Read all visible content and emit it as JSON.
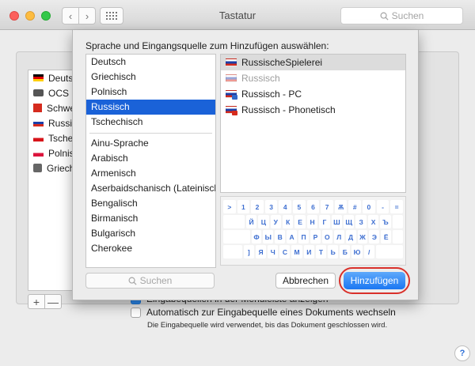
{
  "window": {
    "title": "Tastatur",
    "search_placeholder": "Suchen",
    "nav_back": "‹",
    "nav_forward": "›"
  },
  "background": {
    "inputs": [
      {
        "name": "Deutsch",
        "flag": "de"
      },
      {
        "name": "OCS",
        "flag": "ocs"
      },
      {
        "name": "Schweiz",
        "flag": "ch"
      },
      {
        "name": "Russisch",
        "flag": "ru"
      },
      {
        "name": "Tschechisch",
        "flag": "cz"
      },
      {
        "name": "Polnisch",
        "flag": "pl"
      },
      {
        "name": "Griechisch",
        "flag": "gr"
      }
    ],
    "add_label": "+",
    "remove_label": "—",
    "menubar_checkbox": "Eingabequellen in der Menüleiste anzeigen",
    "auto_switch_checkbox": "Automatisch zur Eingabequelle eines Dokuments wechseln",
    "auto_switch_note": "Die Eingabequelle wird verwendet, bis das Dokument geschlossen wird.",
    "help_label": "?"
  },
  "sheet": {
    "title": "Sprache und Eingangsquelle zum Hinzufügen auswählen:",
    "languages_top": [
      "Deutsch",
      "Griechisch",
      "Polnisch",
      "Russisch",
      "Tschechisch"
    ],
    "languages_rest": [
      "Ainu-Sprache",
      "Arabisch",
      "Armenisch",
      "Aserbaidschanisch (Lateinisch)",
      "Bengalisch",
      "Birmanisch",
      "Bulgarisch",
      "Cherokee"
    ],
    "selected_language": "Russisch",
    "sources": [
      {
        "name": "RussischeSpielerei",
        "state": "selected",
        "badge": ""
      },
      {
        "name": "Russisch",
        "state": "dimmed",
        "badge": ""
      },
      {
        "name": "Russisch - PC",
        "state": "normal",
        "badge": "pc"
      },
      {
        "name": "Russisch - Phonetisch",
        "state": "normal",
        "badge": "phon"
      }
    ],
    "keyboard_rows": [
      [
        ">",
        "1",
        "2",
        "3",
        "4",
        "5",
        "6",
        "7",
        "Ѫ",
        "#",
        "0",
        "-",
        "="
      ],
      [
        "Й",
        "Ц",
        "У",
        "К",
        "Е",
        "Н",
        "Г",
        "Ш",
        "Щ",
        "З",
        "Х",
        "Ъ"
      ],
      [
        "Ф",
        "Ы",
        "В",
        "А",
        "П",
        "Р",
        "О",
        "Л",
        "Д",
        "Ж",
        "Э",
        "Ё"
      ],
      [
        "]",
        "Я",
        "Ч",
        "С",
        "М",
        "И",
        "Т",
        "Ь",
        "Б",
        "Ю",
        "/"
      ]
    ],
    "search_placeholder": "Suchen",
    "cancel_label": "Abbrechen",
    "add_label": "Hinzufügen"
  },
  "colors": {
    "accent": "#1a62d8",
    "highlight_ring": "#d9302a"
  }
}
